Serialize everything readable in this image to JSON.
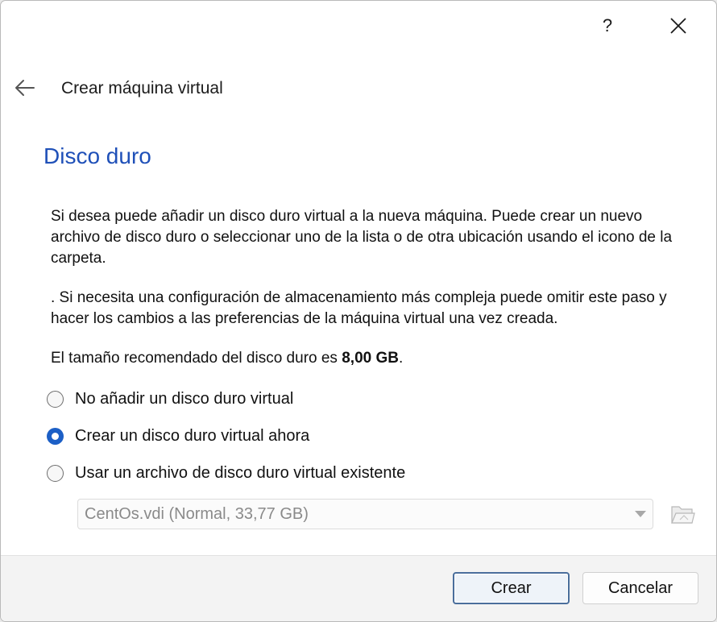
{
  "titlebar": {
    "help_label": "?",
    "help_icon": "question-mark-icon",
    "close_icon": "close-icon"
  },
  "header": {
    "back_icon": "arrow-left-icon",
    "title": "Crear máquina virtual"
  },
  "page": {
    "title": "Disco duro",
    "paragraph1": "Si desea puede añadir un disco duro virtual a la nueva máquina. Puede crear un nuevo archivo de disco duro o seleccionar uno de la lista o de otra ubicación usando el icono de la carpeta.",
    "paragraph2": ". Si necesita una configuración de almacenamiento más compleja puede omitir este paso y hacer los cambios a las preferencias de la máquina virtual una vez creada.",
    "recommended_prefix": "El tamaño recomendado del disco duro es ",
    "recommended_size": "8,00 GB",
    "recommended_suffix": "."
  },
  "options": [
    {
      "label": "No añadir un disco duro virtual",
      "checked": false
    },
    {
      "label": "Crear un disco duro virtual ahora",
      "checked": true
    },
    {
      "label": "Usar un archivo de disco duro virtual existente",
      "checked": false
    }
  ],
  "disk_select": {
    "value": "CentOs.vdi (Normal, 33,77 GB)",
    "disabled": true,
    "folder_icon": "folder-open-icon"
  },
  "footer": {
    "create_label": "Crear",
    "cancel_label": "Cancelar"
  },
  "colors": {
    "title_blue": "#1f50b8",
    "radio_checked": "#1c5fc6",
    "default_button_border": "#4a6e9c"
  }
}
